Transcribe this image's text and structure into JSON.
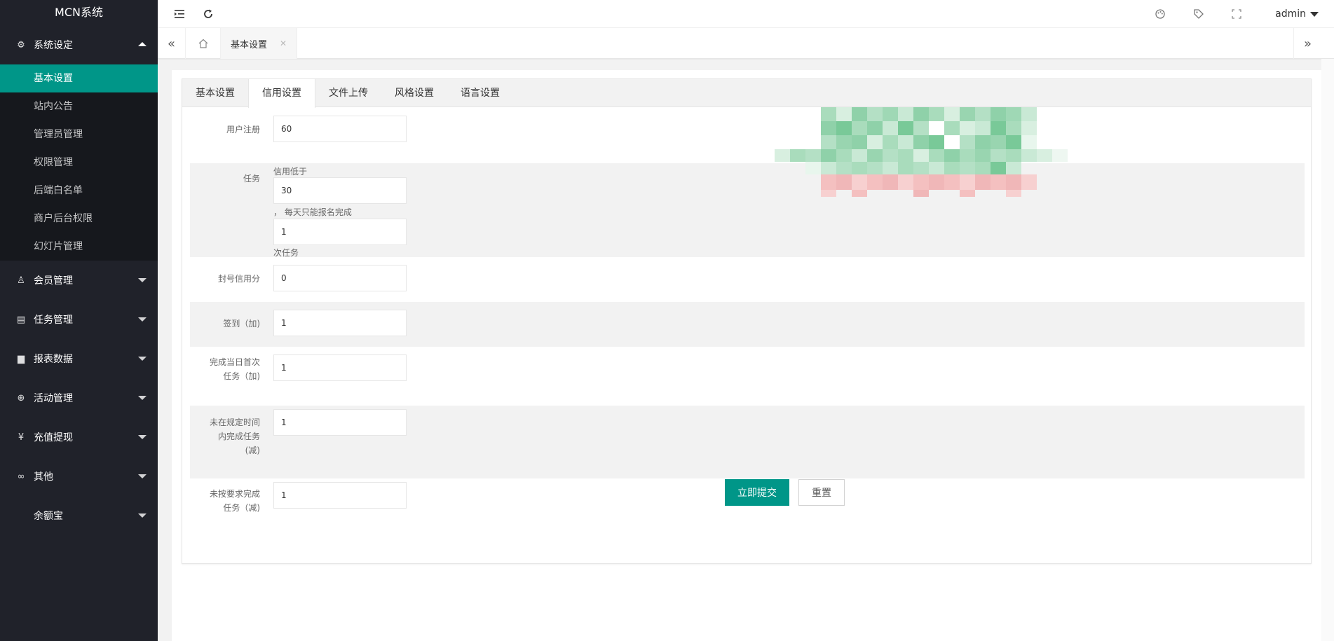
{
  "app": {
    "title": "MCN系统"
  },
  "sidebar": {
    "groups": [
      {
        "label": "系统设定",
        "icon": "gear-icon",
        "expanded": true,
        "items": [
          "基本设置",
          "站内公告",
          "管理员管理",
          "权限管理",
          "后端白名单",
          "商户后台权限",
          "幻灯片管理"
        ],
        "active_index": 0
      },
      {
        "label": "会员管理",
        "icon": "user-icon"
      },
      {
        "label": "任务管理",
        "icon": "document-icon"
      },
      {
        "label": "报表数据",
        "icon": "chart-icon"
      },
      {
        "label": "活动管理",
        "icon": "binoculars-icon"
      },
      {
        "label": "充值提现",
        "icon": "yen-icon"
      },
      {
        "label": "其他",
        "icon": "link-icon"
      },
      {
        "label": "余额宝",
        "icon": ""
      }
    ]
  },
  "header": {
    "user": "admin"
  },
  "tabbar": {
    "current_tab": "基本设置"
  },
  "form": {
    "tabs": [
      "基本设置",
      "信用设置",
      "文件上传",
      "风格设置",
      "语言设置"
    ],
    "active_tab": 1,
    "fields": {
      "register": {
        "label": "用户注册",
        "value": "60"
      },
      "task": {
        "label": "任务",
        "hint_before": "信用低于",
        "value1": "30",
        "hint_mid": "， 每天只能报名完成",
        "value2": "1",
        "hint_after": "次任务"
      },
      "ban": {
        "label": "封号信用分",
        "value": "0"
      },
      "signin": {
        "label": "签到（加)",
        "value": "1"
      },
      "first_task_line1": "完成当日首次",
      "first_task_line2": "任务（加)",
      "first_task_value": "1",
      "overdue_line1": "未在规定时间",
      "overdue_line2": "内完成任务",
      "overdue_line3": "(减)",
      "overdue_value": "1",
      "unqualified_line1": "未按要求完成",
      "unqualified_line2": "任务（减)",
      "unqualified_value": "1"
    },
    "submit_label": "立即提交",
    "reset_label": "重置"
  },
  "colors": {
    "accent": "#009688",
    "sidebar_bg": "#20222a"
  }
}
